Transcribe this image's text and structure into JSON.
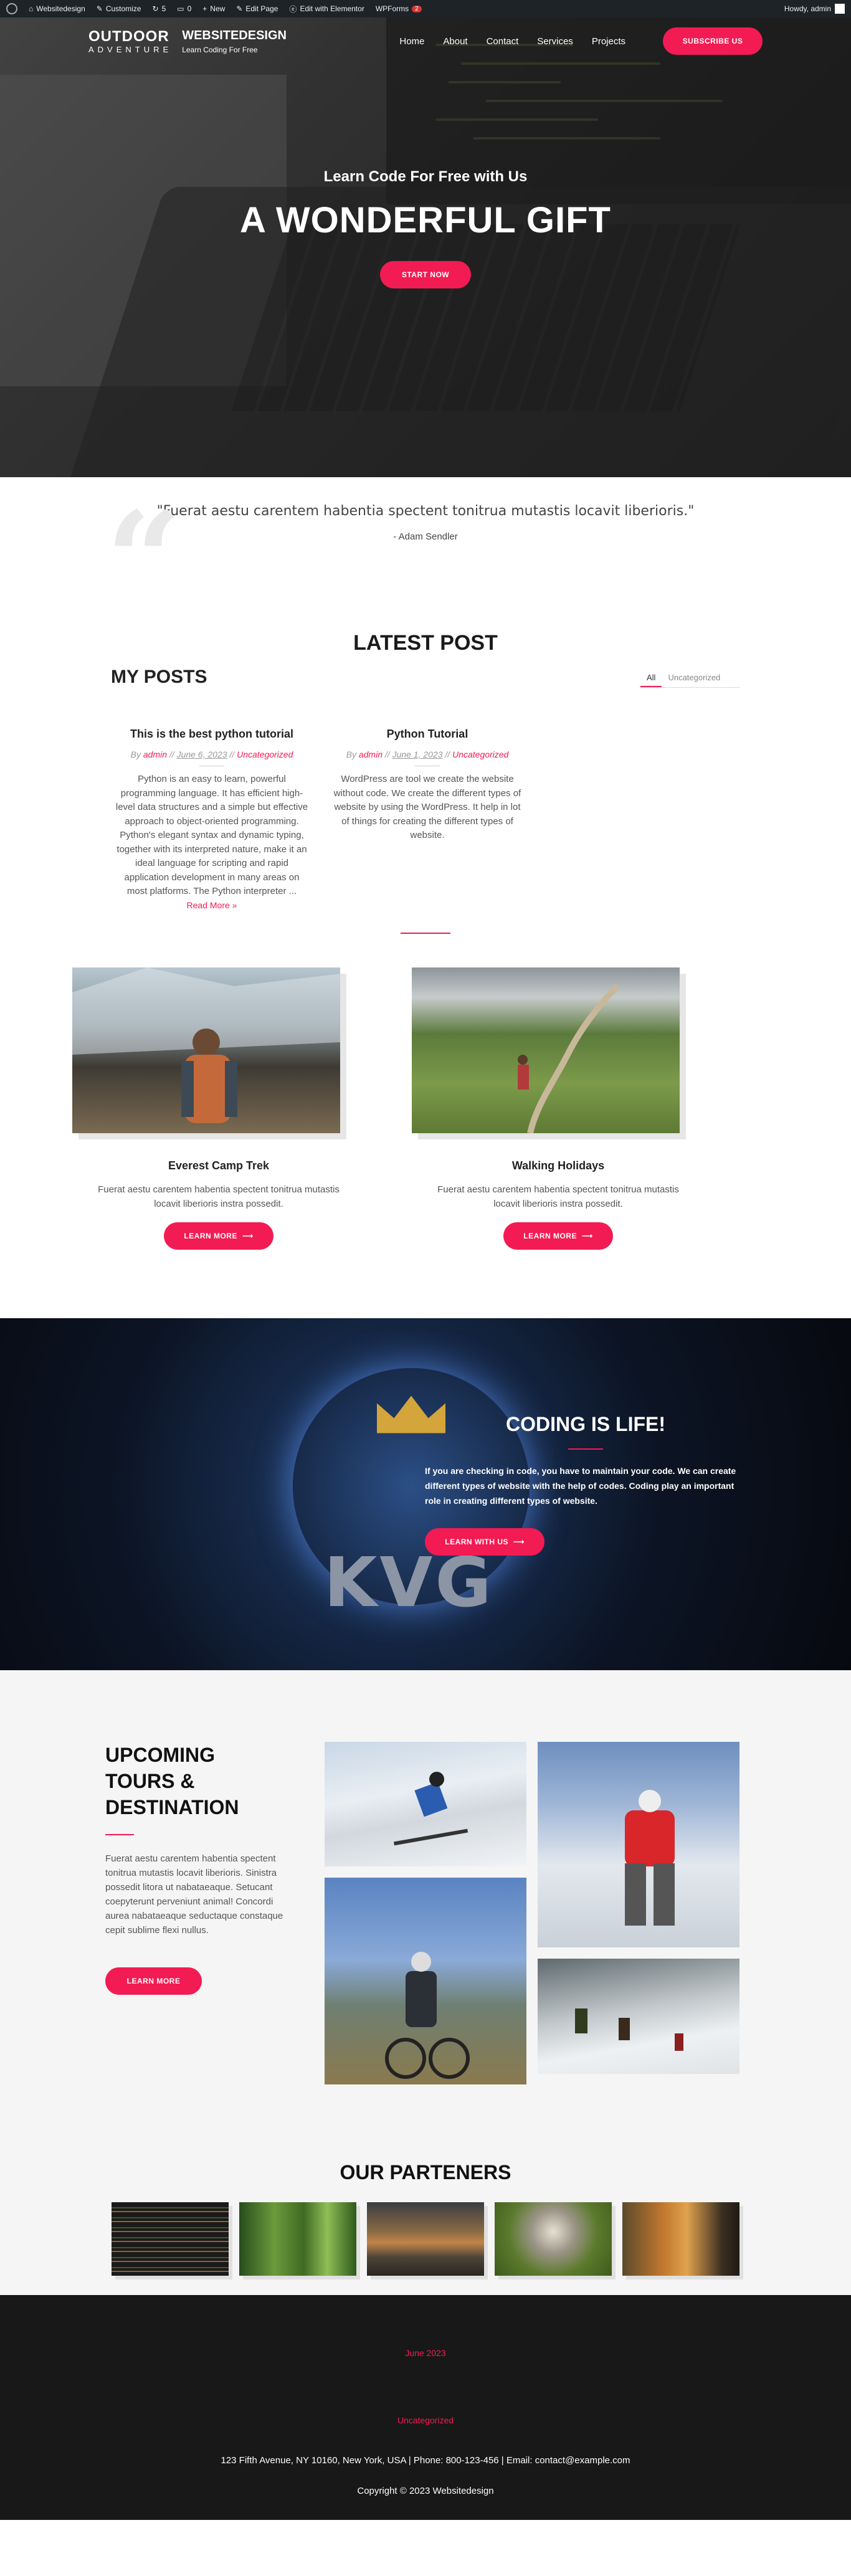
{
  "admin_bar": {
    "site_name": "Websitedesign",
    "customize": "Customize",
    "updates_count": "5",
    "comments_count": "0",
    "new_label": "New",
    "edit_page": "Edit Page",
    "edit_elementor": "Edit with Elementor",
    "wpforms": "WPForms",
    "wpforms_badge": "2",
    "howdy": "Howdy, admin"
  },
  "header": {
    "logo_top": "OUTDOOR",
    "logo_bottom": "ADVENTURE",
    "site_title": "WEBSITEDESIGN",
    "tagline": "Learn Coding For Free",
    "nav": [
      "Home",
      "About",
      "Contact",
      "Services",
      "Projects"
    ],
    "subscribe_label": "SUBSCRIBE US"
  },
  "hero": {
    "subtitle": "Learn Code For Free with Us",
    "title": "A WONDERFUL GIFT",
    "button_label": "START NOW"
  },
  "quote": {
    "text": "\"Fuerat aestu carentem habentia spectent tonitrua mutastis locavit liberioris.\"",
    "author": "- Adam Sendler"
  },
  "latest": {
    "title": "LATEST POST",
    "section_title": "MY POSTS",
    "filters": [
      "All",
      "Uncategorized"
    ],
    "posts": [
      {
        "title": "This is the best python tutorial",
        "by": "By",
        "author": "admin",
        "date": "June 6, 2023",
        "category": "Uncategorized",
        "excerpt": "Python is an easy to learn, powerful programming language. It has efficient high-level data structures and a simple but effective approach to object-oriented programming. Python's elegant syntax and dynamic typing, together with its interpreted nature, make it an ideal language for scripting and rapid application development in many areas on most platforms. The Python interpreter ...",
        "read_more": "Read More »"
      },
      {
        "title": "Python Tutorial",
        "by": "By",
        "author": "admin",
        "date": "June 1, 2023",
        "category": "Uncategorized",
        "excerpt": "WordPress are tool we create the website without code. We create the different types of website by using the WordPress. It help in lot of things for creating the different types of website.",
        "read_more": ""
      }
    ]
  },
  "tours": [
    {
      "title": "Everest Camp Trek",
      "text": "Fuerat aestu carentem habentia spectent tonitrua mutastis locavit liberioris instra possedit.",
      "button_label": "LEARN MORE"
    },
    {
      "title": "Walking Holidays",
      "text": "Fuerat aestu carentem habentia spectent tonitrua mutastis locavit liberioris instra possedit.",
      "button_label": "LEARN MORE"
    }
  ],
  "coding": {
    "title": "CODING IS LIFE!",
    "text": "If you are checking in code, you have to maintain your code. We can create different types of website with the help of codes. Coding play an important role in creating different types of website.",
    "button_label": "LEARN WITH US",
    "logo_text": "KVG"
  },
  "upcoming": {
    "title": "UPCOMING TOURS & DESTINATION",
    "text": "Fuerat aestu carentem habentia spectent tonitrua mutastis locavit liberioris. Sinistra possedit litora ut nabataeaque. Setucant coepyterunt perveniunt animal! Concordi aurea nabataeaque seductaque constaque cepit sublime flexi nullus.",
    "button_label": "LEARN MORE"
  },
  "partners": {
    "title": "OUR PARTENERS"
  },
  "footer": {
    "date": "June 2023",
    "category": "Uncategorized",
    "address": "123 Fifth Avenue, NY 10160, New York, USA | Phone: 800-123-456 | Email: contact@example.com",
    "copyright": "Copyright © 2023 Websitedesign"
  },
  "colors": {
    "accent": "#f31b53",
    "admin_bar": "#1d2327",
    "footer": "#181818"
  }
}
